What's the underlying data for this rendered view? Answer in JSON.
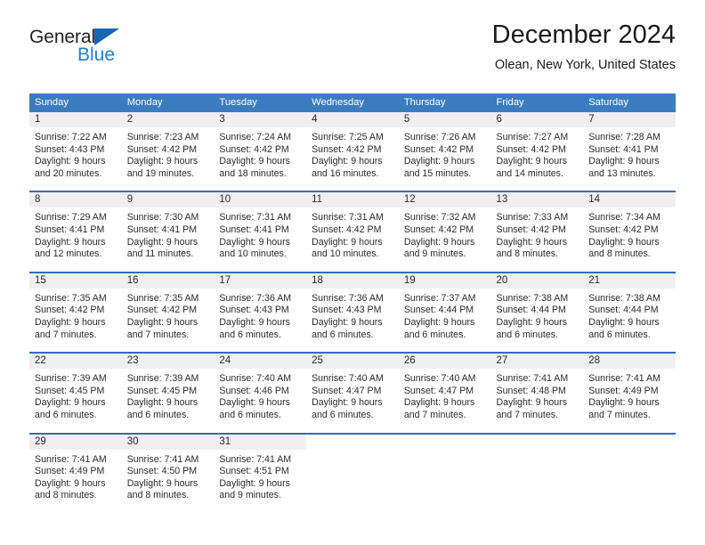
{
  "brand": {
    "name_part1": "General",
    "name_part2": "Blue",
    "triangle_color": "#1567b3",
    "blue_text_color": "#1f7fd0"
  },
  "header": {
    "title": "December 2024",
    "location": "Olean, New York, United States"
  },
  "theme": {
    "header_blue": "#3b7cc0",
    "row_divider_blue": "#2f6eb5",
    "daynum_band_gray": "#efefef",
    "text_color": "#2b2b2b"
  },
  "columns": [
    "Sunday",
    "Monday",
    "Tuesday",
    "Wednesday",
    "Thursday",
    "Friday",
    "Saturday"
  ],
  "weeks": [
    [
      {
        "day": "1",
        "sunrise": "Sunrise: 7:22 AM",
        "sunset": "Sunset: 4:43 PM",
        "daylight1": "Daylight: 9 hours",
        "daylight2": "and 20 minutes."
      },
      {
        "day": "2",
        "sunrise": "Sunrise: 7:23 AM",
        "sunset": "Sunset: 4:42 PM",
        "daylight1": "Daylight: 9 hours",
        "daylight2": "and 19 minutes."
      },
      {
        "day": "3",
        "sunrise": "Sunrise: 7:24 AM",
        "sunset": "Sunset: 4:42 PM",
        "daylight1": "Daylight: 9 hours",
        "daylight2": "and 18 minutes."
      },
      {
        "day": "4",
        "sunrise": "Sunrise: 7:25 AM",
        "sunset": "Sunset: 4:42 PM",
        "daylight1": "Daylight: 9 hours",
        "daylight2": "and 16 minutes."
      },
      {
        "day": "5",
        "sunrise": "Sunrise: 7:26 AM",
        "sunset": "Sunset: 4:42 PM",
        "daylight1": "Daylight: 9 hours",
        "daylight2": "and 15 minutes."
      },
      {
        "day": "6",
        "sunrise": "Sunrise: 7:27 AM",
        "sunset": "Sunset: 4:42 PM",
        "daylight1": "Daylight: 9 hours",
        "daylight2": "and 14 minutes."
      },
      {
        "day": "7",
        "sunrise": "Sunrise: 7:28 AM",
        "sunset": "Sunset: 4:41 PM",
        "daylight1": "Daylight: 9 hours",
        "daylight2": "and 13 minutes."
      }
    ],
    [
      {
        "day": "8",
        "sunrise": "Sunrise: 7:29 AM",
        "sunset": "Sunset: 4:41 PM",
        "daylight1": "Daylight: 9 hours",
        "daylight2": "and 12 minutes."
      },
      {
        "day": "9",
        "sunrise": "Sunrise: 7:30 AM",
        "sunset": "Sunset: 4:41 PM",
        "daylight1": "Daylight: 9 hours",
        "daylight2": "and 11 minutes."
      },
      {
        "day": "10",
        "sunrise": "Sunrise: 7:31 AM",
        "sunset": "Sunset: 4:41 PM",
        "daylight1": "Daylight: 9 hours",
        "daylight2": "and 10 minutes."
      },
      {
        "day": "11",
        "sunrise": "Sunrise: 7:31 AM",
        "sunset": "Sunset: 4:42 PM",
        "daylight1": "Daylight: 9 hours",
        "daylight2": "and 10 minutes."
      },
      {
        "day": "12",
        "sunrise": "Sunrise: 7:32 AM",
        "sunset": "Sunset: 4:42 PM",
        "daylight1": "Daylight: 9 hours",
        "daylight2": "and 9 minutes."
      },
      {
        "day": "13",
        "sunrise": "Sunrise: 7:33 AM",
        "sunset": "Sunset: 4:42 PM",
        "daylight1": "Daylight: 9 hours",
        "daylight2": "and 8 minutes."
      },
      {
        "day": "14",
        "sunrise": "Sunrise: 7:34 AM",
        "sunset": "Sunset: 4:42 PM",
        "daylight1": "Daylight: 9 hours",
        "daylight2": "and 8 minutes."
      }
    ],
    [
      {
        "day": "15",
        "sunrise": "Sunrise: 7:35 AM",
        "sunset": "Sunset: 4:42 PM",
        "daylight1": "Daylight: 9 hours",
        "daylight2": "and 7 minutes."
      },
      {
        "day": "16",
        "sunrise": "Sunrise: 7:35 AM",
        "sunset": "Sunset: 4:42 PM",
        "daylight1": "Daylight: 9 hours",
        "daylight2": "and 7 minutes."
      },
      {
        "day": "17",
        "sunrise": "Sunrise: 7:36 AM",
        "sunset": "Sunset: 4:43 PM",
        "daylight1": "Daylight: 9 hours",
        "daylight2": "and 6 minutes."
      },
      {
        "day": "18",
        "sunrise": "Sunrise: 7:36 AM",
        "sunset": "Sunset: 4:43 PM",
        "daylight1": "Daylight: 9 hours",
        "daylight2": "and 6 minutes."
      },
      {
        "day": "19",
        "sunrise": "Sunrise: 7:37 AM",
        "sunset": "Sunset: 4:44 PM",
        "daylight1": "Daylight: 9 hours",
        "daylight2": "and 6 minutes."
      },
      {
        "day": "20",
        "sunrise": "Sunrise: 7:38 AM",
        "sunset": "Sunset: 4:44 PM",
        "daylight1": "Daylight: 9 hours",
        "daylight2": "and 6 minutes."
      },
      {
        "day": "21",
        "sunrise": "Sunrise: 7:38 AM",
        "sunset": "Sunset: 4:44 PM",
        "daylight1": "Daylight: 9 hours",
        "daylight2": "and 6 minutes."
      }
    ],
    [
      {
        "day": "22",
        "sunrise": "Sunrise: 7:39 AM",
        "sunset": "Sunset: 4:45 PM",
        "daylight1": "Daylight: 9 hours",
        "daylight2": "and 6 minutes."
      },
      {
        "day": "23",
        "sunrise": "Sunrise: 7:39 AM",
        "sunset": "Sunset: 4:45 PM",
        "daylight1": "Daylight: 9 hours",
        "daylight2": "and 6 minutes."
      },
      {
        "day": "24",
        "sunrise": "Sunrise: 7:40 AM",
        "sunset": "Sunset: 4:46 PM",
        "daylight1": "Daylight: 9 hours",
        "daylight2": "and 6 minutes."
      },
      {
        "day": "25",
        "sunrise": "Sunrise: 7:40 AM",
        "sunset": "Sunset: 4:47 PM",
        "daylight1": "Daylight: 9 hours",
        "daylight2": "and 6 minutes."
      },
      {
        "day": "26",
        "sunrise": "Sunrise: 7:40 AM",
        "sunset": "Sunset: 4:47 PM",
        "daylight1": "Daylight: 9 hours",
        "daylight2": "and 7 minutes."
      },
      {
        "day": "27",
        "sunrise": "Sunrise: 7:41 AM",
        "sunset": "Sunset: 4:48 PM",
        "daylight1": "Daylight: 9 hours",
        "daylight2": "and 7 minutes."
      },
      {
        "day": "28",
        "sunrise": "Sunrise: 7:41 AM",
        "sunset": "Sunset: 4:49 PM",
        "daylight1": "Daylight: 9 hours",
        "daylight2": "and 7 minutes."
      }
    ],
    [
      {
        "day": "29",
        "sunrise": "Sunrise: 7:41 AM",
        "sunset": "Sunset: 4:49 PM",
        "daylight1": "Daylight: 9 hours",
        "daylight2": "and 8 minutes."
      },
      {
        "day": "30",
        "sunrise": "Sunrise: 7:41 AM",
        "sunset": "Sunset: 4:50 PM",
        "daylight1": "Daylight: 9 hours",
        "daylight2": "and 8 minutes."
      },
      {
        "day": "31",
        "sunrise": "Sunrise: 7:41 AM",
        "sunset": "Sunset: 4:51 PM",
        "daylight1": "Daylight: 9 hours",
        "daylight2": "and 9 minutes."
      },
      {
        "day": "",
        "sunrise": "",
        "sunset": "",
        "daylight1": "",
        "daylight2": ""
      },
      {
        "day": "",
        "sunrise": "",
        "sunset": "",
        "daylight1": "",
        "daylight2": ""
      },
      {
        "day": "",
        "sunrise": "",
        "sunset": "",
        "daylight1": "",
        "daylight2": ""
      },
      {
        "day": "",
        "sunrise": "",
        "sunset": "",
        "daylight1": "",
        "daylight2": ""
      }
    ]
  ]
}
